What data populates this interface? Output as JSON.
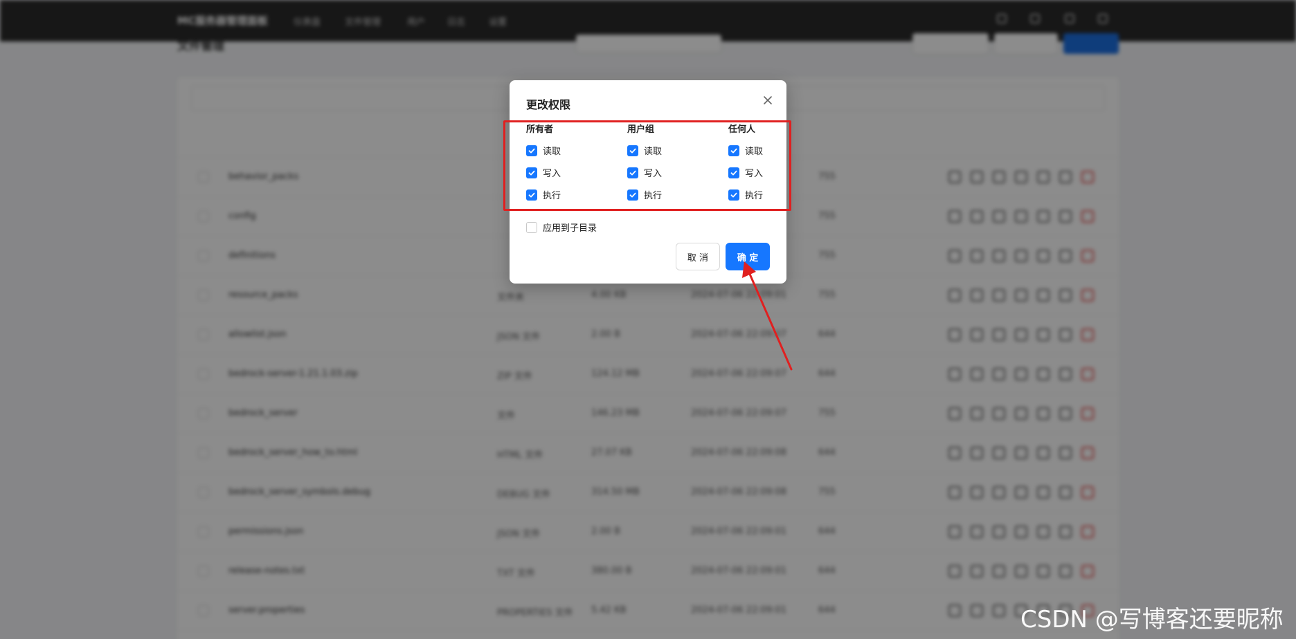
{
  "app": {
    "brand": "MC服务器管理面板",
    "nav": [
      "仪表盘",
      "文件管理",
      "用户",
      "日志",
      "设置"
    ],
    "page_title": "文件管理"
  },
  "files": [
    {
      "name": "behavior_packs",
      "type": "",
      "size": "",
      "date": "",
      "perm": "755"
    },
    {
      "name": "config",
      "type": "",
      "size": "",
      "date": "",
      "perm": "755"
    },
    {
      "name": "definitions",
      "type": "",
      "size": "",
      "date": "",
      "perm": "755"
    },
    {
      "name": "resource_packs",
      "type": "文件夹",
      "size": "4.00 KB",
      "date": "2024-07-06 22:09:01",
      "perm": "755"
    },
    {
      "name": "allowlist.json",
      "type": "JSON 文件",
      "size": "2.00 B",
      "date": "2024-07-06 22:09:07",
      "perm": "644"
    },
    {
      "name": "bedrock-server-1.21.1.03.zip",
      "type": "ZIP 文件",
      "size": "124.12 MB",
      "date": "2024-07-06 22:09:07",
      "perm": "644"
    },
    {
      "name": "bedrock_server",
      "type": "文件",
      "size": "146.23 MB",
      "date": "2024-07-06 22:09:07",
      "perm": "755"
    },
    {
      "name": "bedrock_server_how_to.html",
      "type": "HTML 文件",
      "size": "27.07 KB",
      "date": "2024-07-06 22:09:08",
      "perm": "644"
    },
    {
      "name": "bedrock_server_symbols.debug",
      "type": "DEBUG 文件",
      "size": "314.50 MB",
      "date": "2024-07-06 22:09:08",
      "perm": "755"
    },
    {
      "name": "permissions.json",
      "type": "JSON 文件",
      "size": "2.00 B",
      "date": "2024-07-06 22:09:01",
      "perm": "644"
    },
    {
      "name": "release-notes.txt",
      "type": "TXT 文件",
      "size": "380.00 B",
      "date": "2024-07-06 22:09:01",
      "perm": "644"
    },
    {
      "name": "server.properties",
      "type": "PROPERTIES 文件",
      "size": "5.42 KB",
      "date": "2024-07-06 22:09:01",
      "perm": "644"
    }
  ],
  "modal": {
    "title": "更改权限",
    "columns": [
      {
        "heading": "所有者",
        "options": [
          {
            "label": "读取",
            "checked": true
          },
          {
            "label": "写入",
            "checked": true
          },
          {
            "label": "执行",
            "checked": true
          }
        ]
      },
      {
        "heading": "用户组",
        "options": [
          {
            "label": "读取",
            "checked": true
          },
          {
            "label": "写入",
            "checked": true
          },
          {
            "label": "执行",
            "checked": true
          }
        ]
      },
      {
        "heading": "任何人",
        "options": [
          {
            "label": "读取",
            "checked": true
          },
          {
            "label": "写入",
            "checked": true
          },
          {
            "label": "执行",
            "checked": true
          }
        ]
      }
    ],
    "apply_subdir": {
      "label": "应用到子目录",
      "checked": false
    },
    "cancel_label": "取 消",
    "ok_label": "确 定"
  },
  "colors": {
    "accent": "#1677ff",
    "annotation": "#e02020"
  },
  "watermark": "CSDN @写博客还要昵称"
}
